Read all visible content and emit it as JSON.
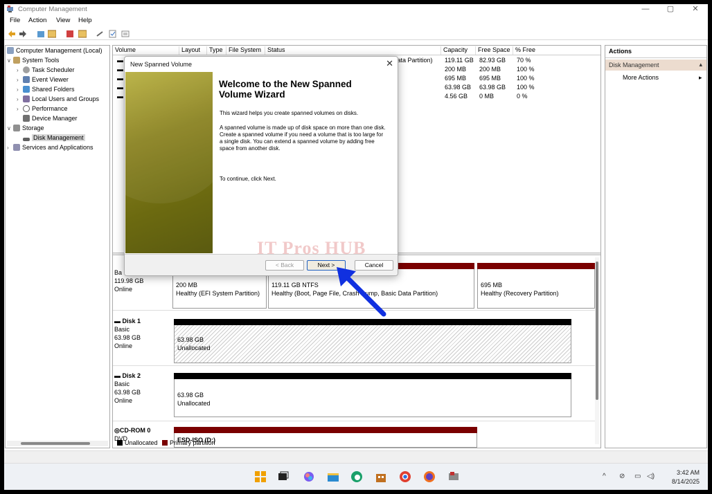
{
  "window": {
    "title": "Computer Management",
    "minimize_glyph": "—",
    "maximize_glyph": "▢",
    "close_glyph": "✕"
  },
  "menu": [
    "File",
    "Action",
    "View",
    "Help"
  ],
  "toolbar_icons": [
    "back-icon",
    "forward-icon",
    "up-icon",
    "show-hide-tree-icon",
    "help-icon",
    "properties-icon",
    "connect-icon",
    "check-icon",
    "list-icon"
  ],
  "tree": {
    "root": "Computer Management (Local)",
    "system_tools": "System Tools",
    "task_scheduler": "Task Scheduler",
    "event_viewer": "Event Viewer",
    "shared_folders": "Shared Folders",
    "local_users": "Local Users and Groups",
    "performance": "Performance",
    "device_manager": "Device Manager",
    "storage": "Storage",
    "disk_management": "Disk Management",
    "services": "Services and Applications"
  },
  "volume_columns": [
    "Volume",
    "Layout",
    "Type",
    "File System",
    "Status",
    "Capacity",
    "Free Space",
    "% Free"
  ],
  "volumes": [
    {
      "status_tail": "Data Partition)",
      "capacity": "119.11 GB",
      "free": "82.93 GB",
      "pct": "70 %"
    },
    {
      "status_tail": "",
      "capacity": "200 MB",
      "free": "200 MB",
      "pct": "100 %"
    },
    {
      "status_tail": "",
      "capacity": "695 MB",
      "free": "695 MB",
      "pct": "100 %"
    },
    {
      "status_tail": "",
      "capacity": "63.98 GB",
      "free": "63.98 GB",
      "pct": "100 %"
    },
    {
      "status_tail": "",
      "capacity": "4.56 GB",
      "free": "0 MB",
      "pct": "0 %"
    }
  ],
  "disk0": {
    "type_partial": "Ba",
    "size": "119.98 GB",
    "state": "Online",
    "p1_size": "200 MB",
    "p1_status": "Healthy (EFI System Partition)",
    "p2_size": "119.11 GB NTFS",
    "p2_status": "Healthy (Boot, Page File, Crash Dump, Basic Data Partition)",
    "p3_size": "695 MB",
    "p3_status": "Healthy (Recovery Partition)"
  },
  "disk1": {
    "name": "Disk 1",
    "type": "Basic",
    "size": "63.98 GB",
    "state": "Online",
    "part_size": "63.98 GB",
    "part_status": "Unallocated"
  },
  "disk2": {
    "name": "Disk 2",
    "type": "Basic",
    "size": "63.98 GB",
    "state": "Online",
    "part_size": "63.98 GB",
    "part_status": "Unallocated"
  },
  "cdrom": {
    "name": "CD-ROM 0",
    "type": "DVD",
    "part_label": "ESD-ISO  (D:)"
  },
  "legend": {
    "unallocated": "Unallocated",
    "primary": "Primary partition"
  },
  "actions": {
    "header": "Actions",
    "section": "Disk Management",
    "more": "More Actions",
    "more_arrow": "▸"
  },
  "dialog": {
    "title": "New Spanned Volume",
    "heading": "Welcome to the New Spanned Volume Wizard",
    "p1": "This wizard helps you create spanned volumes on disks.",
    "p2": "A spanned volume is made up of disk space on more than one disk. Create a spanned volume if you need a volume that is too large for a single disk. You can extend a spanned volume by adding free space from another disk.",
    "p3": "To continue, click Next.",
    "back": "< Back",
    "next": "Next >",
    "cancel": "Cancel",
    "close_glyph": "✕"
  },
  "watermark": "IT Pros HUB",
  "clock": {
    "time": "3:42 AM",
    "date": "8/14/2025"
  },
  "colors": {
    "primary_partition": "#7a0000",
    "unallocated": "#000000",
    "arrow": "#1030e0",
    "actions_section": "#ecdccf"
  }
}
